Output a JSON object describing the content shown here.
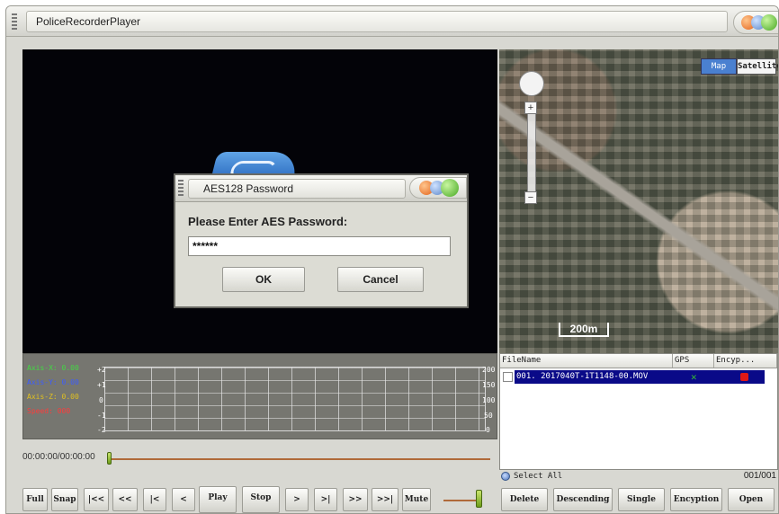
{
  "window": {
    "title": "PoliceRecorderPlayer"
  },
  "dialog": {
    "title": "AES128 Password",
    "prompt": "Please Enter AES Password:",
    "password_value": "******",
    "ok_label": "OK",
    "cancel_label": "Cancel"
  },
  "map": {
    "type_map": "Map",
    "type_satellite": "Satellite",
    "scale_label": "200m"
  },
  "sensor": {
    "axis_x": "Axis-X: 0.00",
    "axis_y": "Axis-Y: 0.00",
    "axis_z": "Axis-Z: 0.00",
    "speed": "Speed: 000",
    "ticks_left": [
      "+2",
      "+1",
      "0",
      "-1",
      "-2"
    ],
    "ticks_right": [
      "200",
      "150",
      "100",
      "50",
      "0"
    ],
    "colors": {
      "axis_x": "#43d843",
      "axis_y": "#3c5cff",
      "axis_z": "#e0c020",
      "speed": "#ff3b3b"
    }
  },
  "playback": {
    "time": "00:00:00/00:00:00"
  },
  "file_list": {
    "headers": [
      "FileName",
      "GPS",
      "Encyp..."
    ],
    "rows": [
      {
        "name": "001. 2017040T-1T1148-00.MOV",
        "gps": "✕"
      }
    ],
    "select_all_label": "Select All",
    "count": "001/001"
  },
  "toolbar": {
    "buttons": [
      "Full",
      "Snap",
      "|<<",
      "<<",
      "|<",
      "<",
      "Play",
      "Stop",
      ">",
      ">|",
      ">>",
      ">>|",
      "Mute"
    ],
    "right_buttons": [
      "Delete",
      "Descending",
      "Single",
      "Encyption",
      "Open"
    ]
  }
}
